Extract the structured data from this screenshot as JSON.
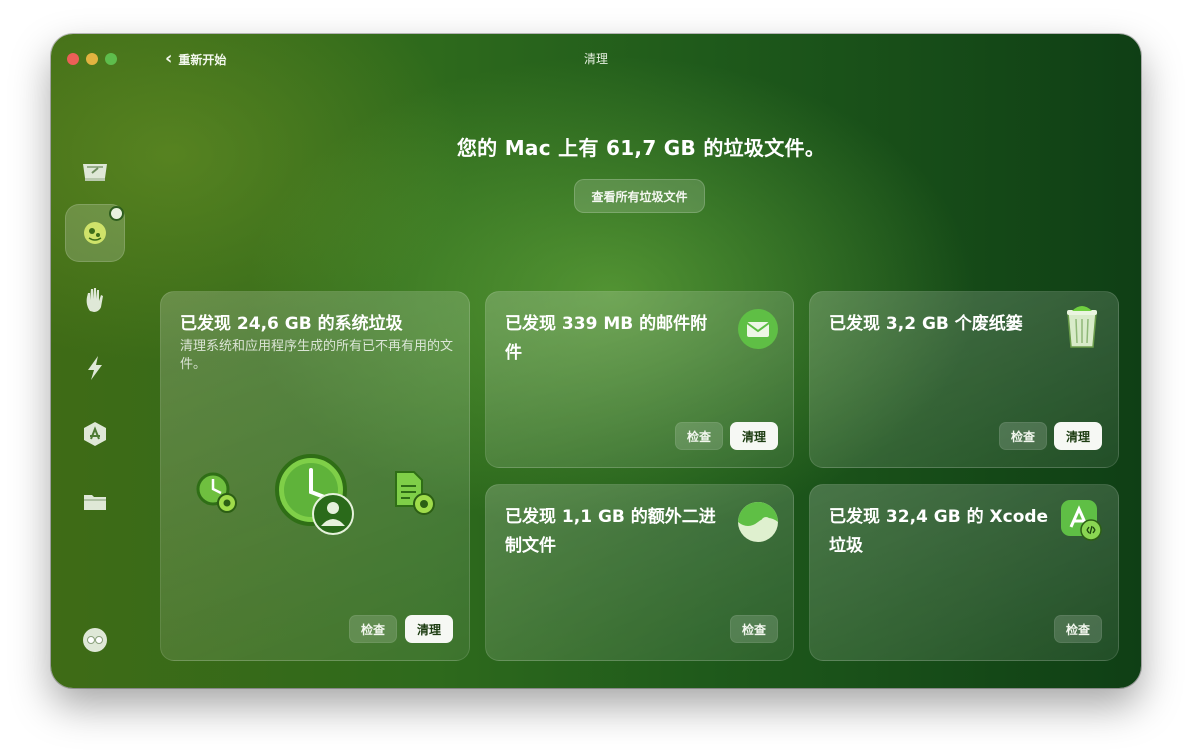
{
  "window": {
    "back_label": "重新开始",
    "title": "清理"
  },
  "sidebar": {
    "items": [
      {
        "icon": "disk-icon"
      },
      {
        "icon": "shield-virus-icon",
        "active": true,
        "badge": true
      },
      {
        "icon": "hand-icon"
      },
      {
        "icon": "lightning-icon"
      },
      {
        "icon": "app-store-icon"
      },
      {
        "icon": "folder-icon"
      }
    ],
    "bottom_icon": "assistant-icon"
  },
  "hero": {
    "title": "您的 Mac 上有 61,7 GB 的垃圾文件。",
    "button_label": "查看所有垃圾文件"
  },
  "cards": {
    "system": {
      "title": "已发现 24,6 GB 的系统垃圾",
      "description": "清理系统和应用程序生成的所有已不再有用的文件。",
      "inspect_label": "检查",
      "clean_label": "清理"
    },
    "mail": {
      "title_line1": "已发现 339 MB 的邮件附",
      "title_line2": "件",
      "inspect_label": "检查",
      "clean_label": "清理"
    },
    "trash": {
      "title": "已发现 3,2 GB 个废纸篓",
      "inspect_label": "检查",
      "clean_label": "清理"
    },
    "binaries": {
      "title_line1": "已发现 1,1 GB 的额外二进",
      "title_line2": "制文件",
      "inspect_label": "检查"
    },
    "xcode": {
      "title_line1": "已发现 32,4 GB 的 Xcode",
      "title_line2": "垃圾",
      "inspect_label": "检查"
    }
  },
  "colors": {
    "accent": "#5fb04a",
    "clean_button": "#f6f8f4",
    "background_dark": "#0f3f15"
  }
}
